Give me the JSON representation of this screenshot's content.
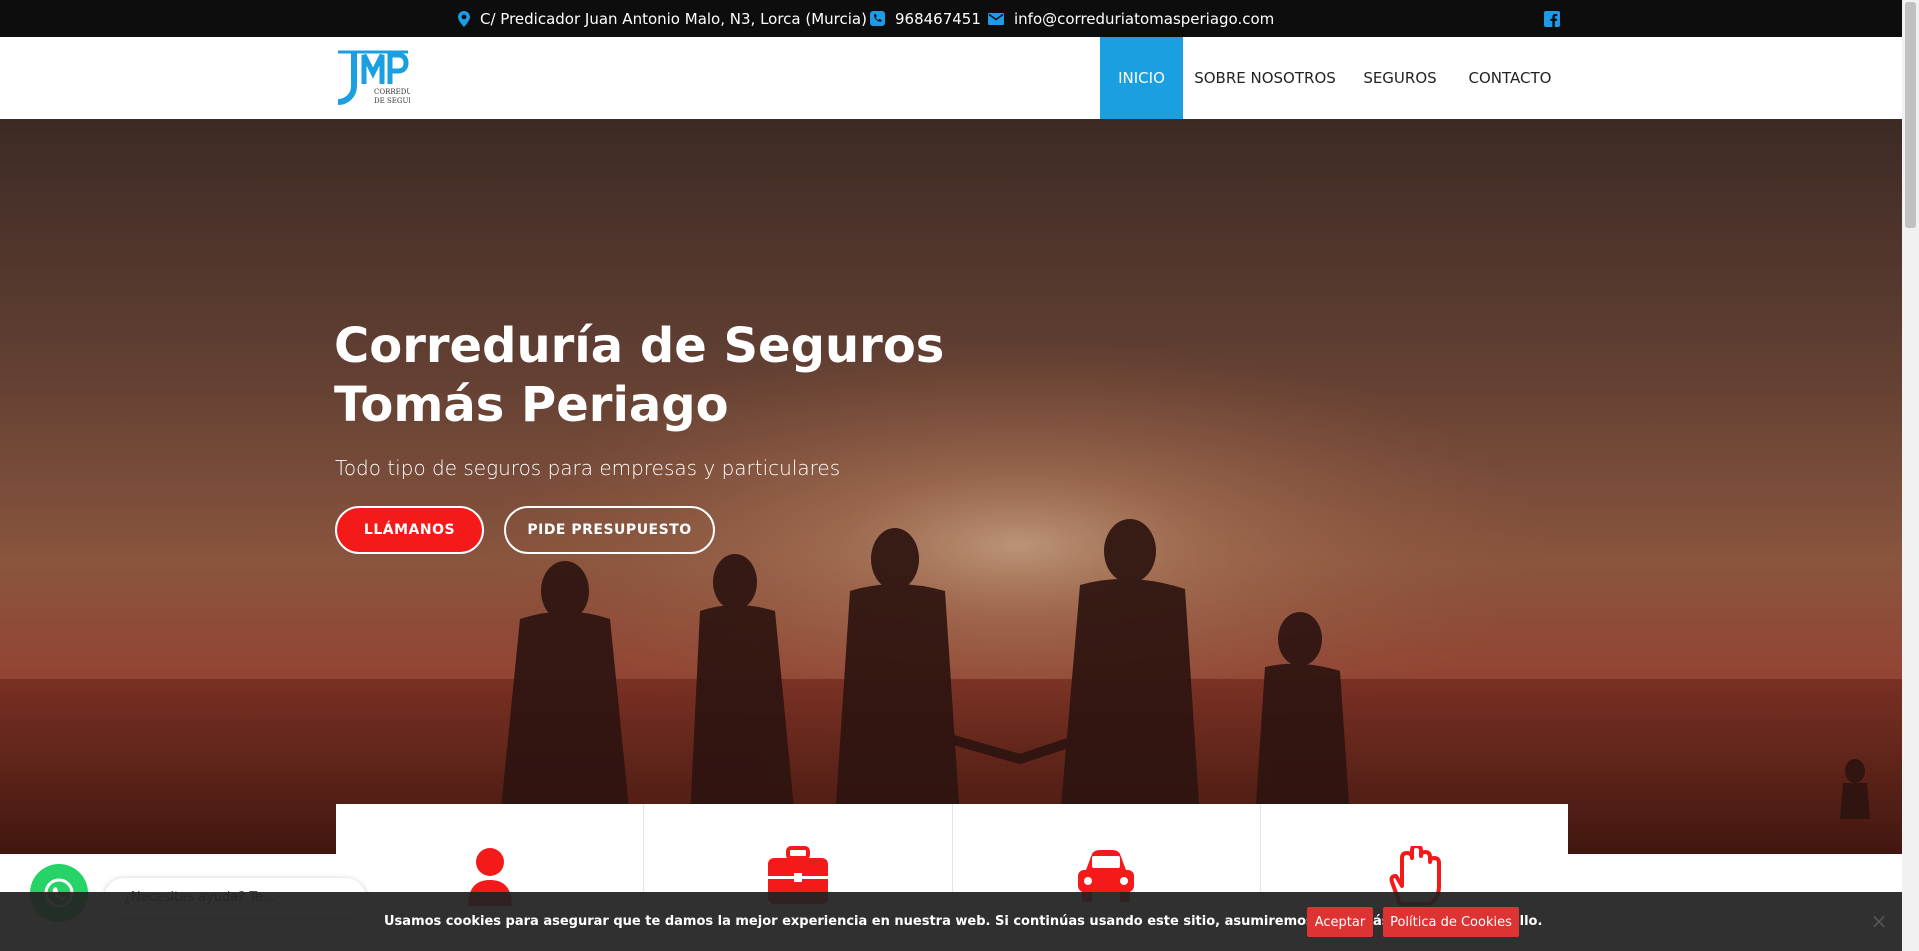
{
  "topbar": {
    "address": "C/ Predicador Juan Antonio Malo, N3, Lorca (Murcia)",
    "phone": "968467451",
    "email": "info@correduriatomasperiago.com"
  },
  "header": {
    "logo_text": "CORREDURÍA DE SEGUROS",
    "nav": [
      "INICIO",
      "SOBRE NOSOTROS",
      "SEGUROS",
      "CONTACTO"
    ],
    "active": "INICIO"
  },
  "hero": {
    "title_line1": "Correduría de Seguros",
    "title_line2": "Tomás Periago",
    "subtitle": "Todo tipo de seguros para empresas y particulares",
    "button_call": "LLÁMANOS",
    "button_quote": "PIDE PRESUPUESTO"
  },
  "features": [
    {
      "icon": "person-icon"
    },
    {
      "icon": "briefcase-icon"
    },
    {
      "icon": "car-icon"
    },
    {
      "icon": "hand-icon"
    }
  ],
  "whatsapp": {
    "bubble_text": "¿Necesitas ayuda? Te..."
  },
  "cookie": {
    "text": "Usamos cookies para asegurar que te damos la mejor experiencia en nuestra web. Si continúas usando este sitio, asumiremos que estás de acuerdo con ello.",
    "accept": "Aceptar",
    "policy": "Política de Cookies",
    "close": "×"
  },
  "colors": {
    "accent_blue": "#1a9fe0",
    "accent_red": "#f41a1a",
    "topbar_bg": "#0d0d0d"
  }
}
